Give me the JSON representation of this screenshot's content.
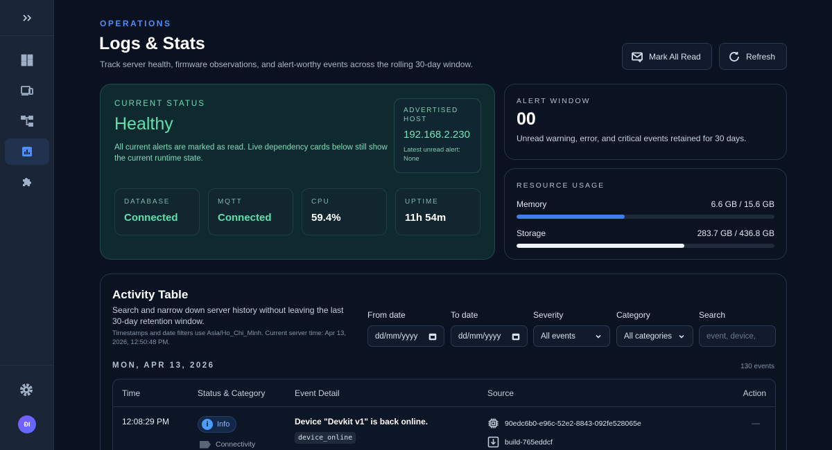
{
  "header": {
    "eyebrow": "OPERATIONS",
    "title": "Logs & Stats",
    "subtitle": "Track server health, firmware observations, and alert-worthy events across the rolling 30-day window.",
    "mark_all_read": "Mark All Read",
    "refresh": "Refresh"
  },
  "sidebar": {
    "items": [
      {
        "icon": "dashboard-icon",
        "active": false
      },
      {
        "icon": "devices-icon",
        "active": false
      },
      {
        "icon": "topology-icon",
        "active": false
      },
      {
        "icon": "chart-icon",
        "active": true
      },
      {
        "icon": "puzzle-icon",
        "active": false
      }
    ],
    "avatar_initials": "ĐI"
  },
  "status": {
    "label": "CURRENT STATUS",
    "value": "Healthy",
    "description": "All current alerts are marked as read. Live dependency cards below still show the current runtime state.",
    "host_label": "ADVERTISED HOST",
    "host_ip": "192.168.2.230",
    "host_note": "Latest unread alert: None",
    "metrics": [
      {
        "label": "DATABASE",
        "value": "Connected"
      },
      {
        "label": "MQTT",
        "value": "Connected"
      },
      {
        "label": "CPU",
        "value": "59.4%"
      },
      {
        "label": "UPTIME",
        "value": "11h 54m"
      }
    ]
  },
  "alert_window": {
    "label": "ALERT WINDOW",
    "value": "00",
    "description": "Unread warning, error, and critical events retained for 30 days."
  },
  "resources": {
    "label": "RESOURCE USAGE",
    "memory": {
      "name": "Memory",
      "value": "6.6 GB / 15.6 GB",
      "fraction": 0.42
    },
    "storage": {
      "name": "Storage",
      "value": "283.7 GB / 436.8 GB",
      "fraction": 0.65
    }
  },
  "activity": {
    "title": "Activity Table",
    "description": "Search and narrow down server history without leaving the last 30-day retention window.",
    "note": "Timestamps and date filters use Asia/Ho_Chi_Minh. Current server time: Apr 13, 2026, 12:50:48 PM.",
    "filters": {
      "from_label": "From date",
      "from_value": "dd/mm/yyyy",
      "to_label": "To date",
      "to_value": "dd/mm/yyyy",
      "severity_label": "Severity",
      "severity_value": "All events",
      "category_label": "Category",
      "category_value": "All categories",
      "search_label": "Search",
      "search_placeholder": "event, device,"
    },
    "date_heading": "MON, APR 13, 2026",
    "event_count": "130 events",
    "columns": [
      "Time",
      "Status & Category",
      "Event Detail",
      "Source",
      "Action"
    ],
    "rows": [
      {
        "time": "12:08:29 PM",
        "severity": "Info",
        "category": "Connectivity",
        "detail": "Device \"Devkit v1\" is back online.",
        "code": "device_online",
        "source_id": "90edc6b0-e96c-52e2-8843-092fe528065e",
        "source_build": "build-765eddcf",
        "action": "—"
      }
    ]
  }
}
